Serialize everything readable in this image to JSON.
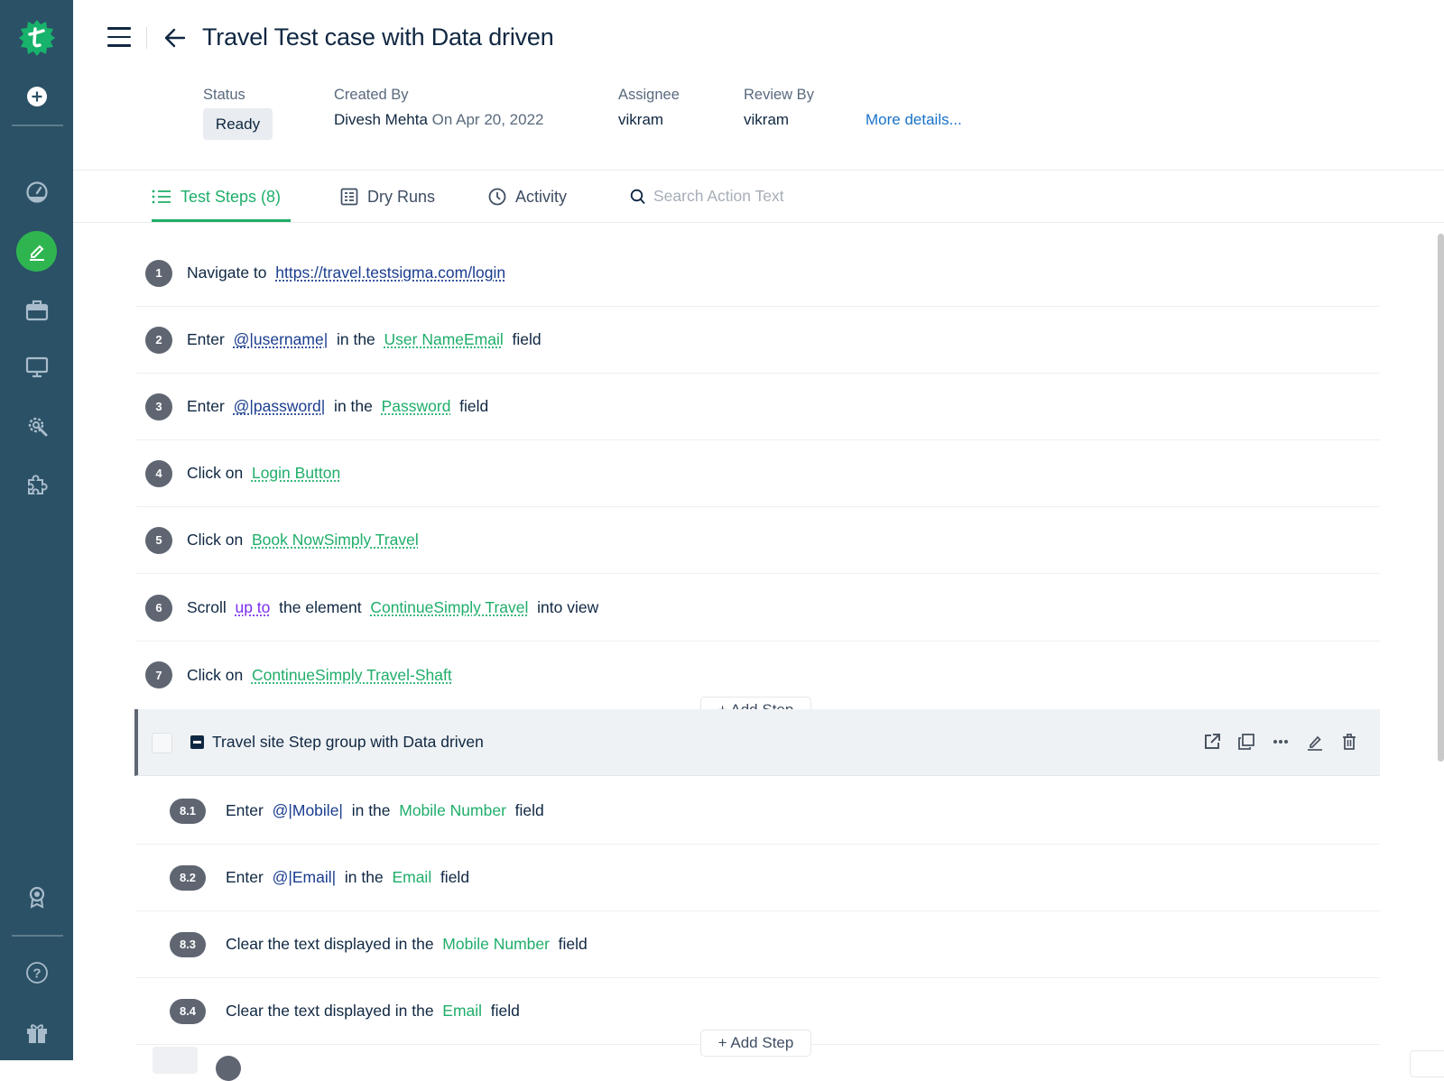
{
  "sidebar": {
    "logo": "testsigma-logo-icon",
    "top_items": [
      {
        "icon": "add-icon"
      },
      {
        "icon": "dashboard-icon"
      },
      {
        "icon": "test-development-icon",
        "active": true
      },
      {
        "icon": "briefcase-icon"
      },
      {
        "icon": "monitor-icon"
      },
      {
        "icon": "settings-wrench-icon"
      },
      {
        "icon": "puzzle-icon"
      }
    ],
    "bottom_items": [
      {
        "icon": "award-icon"
      },
      {
        "icon": "help-icon"
      },
      {
        "icon": "gift-icon"
      }
    ],
    "active_color": "#2fb550",
    "background": "#2b5166"
  },
  "header": {
    "title": "Travel Test case with Data driven",
    "status_label": "Status",
    "status_value": "Ready",
    "created_by_label": "Created By",
    "created_by_name": "Divesh Mehta",
    "created_on": "On Apr 20, 2022",
    "assignee_label": "Assignee",
    "assignee_value": "vikram",
    "review_by_label": "Review By",
    "review_by_value": "vikram",
    "more_details": "More details..."
  },
  "tabs": [
    {
      "label": "Test Steps (8)",
      "icon": "list-icon",
      "active": true
    },
    {
      "label": "Dry Runs",
      "icon": "dry-runs-icon"
    },
    {
      "label": "Activity",
      "icon": "clock-icon"
    }
  ],
  "search": {
    "placeholder": "Search Action Text",
    "value": ""
  },
  "accent_color": "#1fae6a",
  "steps": [
    {
      "num": "1",
      "parts": [
        {
          "t": "Navigate to  "
        },
        {
          "t": "https://travel.testsigma.com/login",
          "k": "url"
        }
      ]
    },
    {
      "num": "2",
      "parts": [
        {
          "t": "Enter  "
        },
        {
          "t": "@|username|",
          "k": "param"
        },
        {
          "t": "  in the  "
        },
        {
          "t": "User NameEmail",
          "k": "el"
        },
        {
          "t": "  field"
        }
      ]
    },
    {
      "num": "3",
      "parts": [
        {
          "t": "Enter  "
        },
        {
          "t": "@|password|",
          "k": "param"
        },
        {
          "t": "  in the  "
        },
        {
          "t": "Password",
          "k": "el"
        },
        {
          "t": "  field"
        }
      ]
    },
    {
      "num": "4",
      "parts": [
        {
          "t": "Click on  "
        },
        {
          "t": "Login Button",
          "k": "el"
        }
      ]
    },
    {
      "num": "5",
      "parts": [
        {
          "t": "Click on  "
        },
        {
          "t": "Book NowSimply Travel",
          "k": "el"
        }
      ]
    },
    {
      "num": "6",
      "parts": [
        {
          "t": "Scroll  "
        },
        {
          "t": "up to",
          "k": "mod"
        },
        {
          "t": "  the element  "
        },
        {
          "t": "ContinueSimply Travel",
          "k": "el"
        },
        {
          "t": "  into view"
        }
      ]
    },
    {
      "num": "7",
      "parts": [
        {
          "t": "Click on  "
        },
        {
          "t": "ContinueSimply Travel-Shaft",
          "k": "el"
        }
      ]
    }
  ],
  "add_step_label": "+ Add Step",
  "group": {
    "title": "Travel site Step group with Data driven",
    "actions": [
      "open-external-icon",
      "copy-icon",
      "more-icon",
      "edit-icon",
      "delete-icon"
    ],
    "sub_steps": [
      {
        "num": "8.1",
        "parts": [
          {
            "t": "Enter  "
          },
          {
            "t": "@|Mobile|",
            "k": "param-plain"
          },
          {
            "t": "  in the  "
          },
          {
            "t": "Mobile Number",
            "k": "el-plain"
          },
          {
            "t": "  field"
          }
        ]
      },
      {
        "num": "8.2",
        "parts": [
          {
            "t": "Enter  "
          },
          {
            "t": "@|Email|",
            "k": "param-plain"
          },
          {
            "t": "  in the  "
          },
          {
            "t": "Email",
            "k": "el-plain"
          },
          {
            "t": "  field"
          }
        ]
      },
      {
        "num": "8.3",
        "parts": [
          {
            "t": "Clear the text displayed in the  "
          },
          {
            "t": "Mobile Number",
            "k": "el-plain"
          },
          {
            "t": "  field"
          }
        ]
      },
      {
        "num": "8.4",
        "parts": [
          {
            "t": "Clear the text displayed in the  "
          },
          {
            "t": "Email",
            "k": "el-plain"
          },
          {
            "t": "  field"
          }
        ]
      }
    ]
  }
}
